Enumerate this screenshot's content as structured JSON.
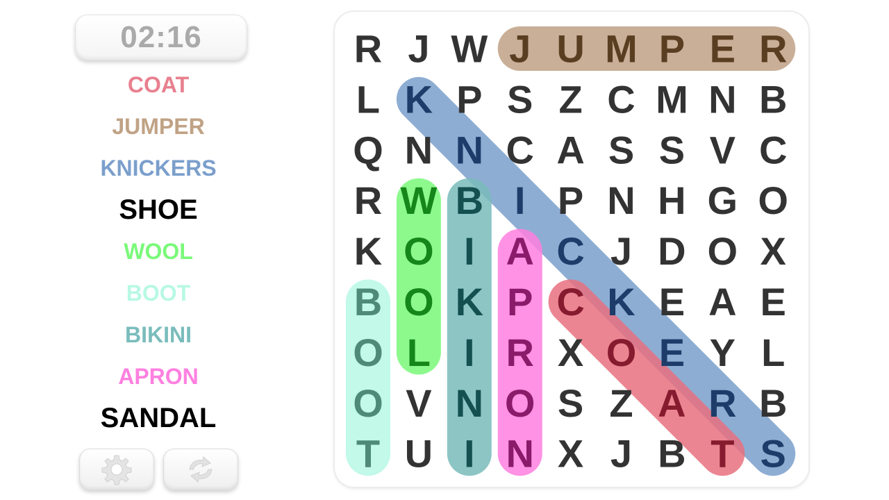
{
  "timer": {
    "value": "02:16"
  },
  "words": [
    {
      "text": "COAT",
      "color": "#e8808f",
      "found": true
    },
    {
      "text": "JUMPER",
      "color": "#c0a285",
      "found": true
    },
    {
      "text": "KNICKERS",
      "color": "#7b9fcc",
      "found": true
    },
    {
      "text": "SHOE",
      "color": "#000000",
      "found": false
    },
    {
      "text": "WOOL",
      "color": "#7af97a",
      "found": true
    },
    {
      "text": "BOOT",
      "color": "#b8f8e4",
      "found": true
    },
    {
      "text": "BIKINI",
      "color": "#7abcbc",
      "found": true
    },
    {
      "text": "APRON",
      "color": "#ff80e0",
      "found": true
    },
    {
      "text": "SANDAL",
      "color": "#000000",
      "found": false
    }
  ],
  "buttons": {
    "settings": {
      "icon": "gear-icon"
    },
    "refresh": {
      "icon": "refresh-icon"
    }
  },
  "grid": {
    "rows": [
      "RJWJUMPER",
      "LKPSZCMNB",
      "QNNCASSVC",
      "RWBIPNHGO",
      "KOIACJDOX",
      "BOKPCKEAE",
      "OLIRXOEYL",
      "OVNOSZARB",
      "TUINXJBTS"
    ]
  },
  "highlights": [
    {
      "word": "JUMPER",
      "start": [
        0,
        3
      ],
      "end": [
        0,
        8
      ],
      "color": "#c0a285",
      "text_color": "#5a3e22"
    },
    {
      "word": "KNICKERS",
      "start": [
        1,
        1
      ],
      "end": [
        8,
        8
      ],
      "color": "#7b9fcc",
      "text_color": "#1d3c6a"
    },
    {
      "word": "COAT",
      "start": [
        5,
        4
      ],
      "end": [
        8,
        7
      ],
      "color": "#e8707f",
      "text_color": "#861a2e"
    },
    {
      "word": "WOOL",
      "start": [
        3,
        1
      ],
      "end": [
        6,
        1
      ],
      "color": "#7af97a",
      "text_color": "#15861a"
    },
    {
      "word": "BOOT",
      "start": [
        5,
        0
      ],
      "end": [
        8,
        0
      ],
      "color": "#b8f8e4",
      "text_color": "#4f8a78"
    },
    {
      "word": "BIKINI",
      "start": [
        3,
        2
      ],
      "end": [
        8,
        2
      ],
      "color": "#7abcbc",
      "text_color": "#155050"
    },
    {
      "word": "APRON",
      "start": [
        4,
        3
      ],
      "end": [
        8,
        3
      ],
      "color": "#ff80e0",
      "text_color": "#8a1a6a"
    }
  ]
}
